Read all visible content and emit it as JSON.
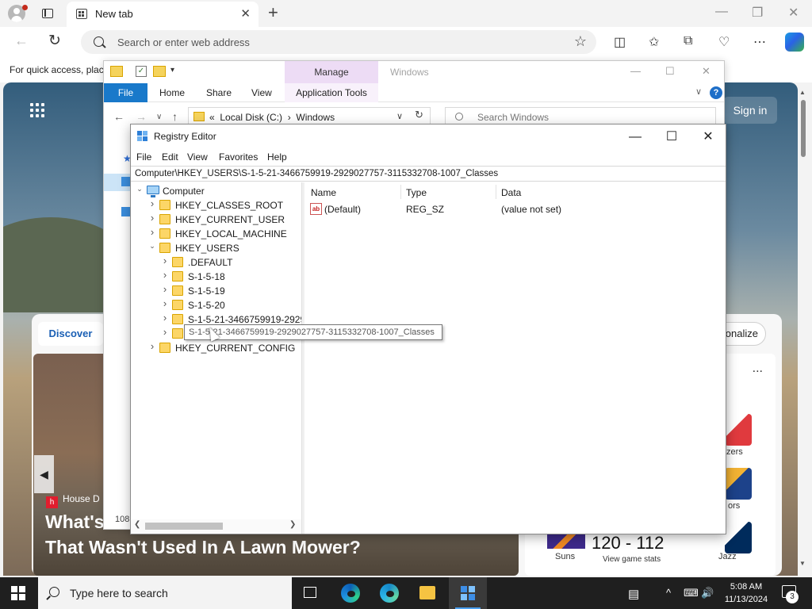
{
  "browser": {
    "tab_title": "New tab",
    "tab_close": "✕",
    "new_tab": "+",
    "window_controls": [
      "—",
      "❐",
      "✕"
    ],
    "address_placeholder": "Search or enter web address",
    "back": "←",
    "refresh": "↻",
    "favorite": "☆",
    "toolbar_icons": [
      "split-screen-icon",
      "favorites-icon",
      "collections-icon",
      "performance-icon",
      "more-icon",
      "copilot-icon"
    ],
    "quick_access_text": "For quick access, place"
  },
  "ntp": {
    "sign_in": "Sign in",
    "discover": "Discover",
    "personalize": "onalize",
    "hero_source": "House D",
    "hero_title_line1": "What's",
    "hero_title_line2": "That Wasn't Used In A Lawn Mower?",
    "sports_more": "...",
    "team1_label": "zers",
    "team2_label": "ors",
    "suns_label": "Suns",
    "score": "120 - 112",
    "score_sub": "View game stats",
    "jazz_label": "Jazz"
  },
  "explorer": {
    "manage": "Manage",
    "title": "Windows",
    "tabs": [
      "File",
      "Home",
      "Share",
      "View"
    ],
    "app_tools": "Application Tools",
    "path": [
      "Local Disk (C:)",
      "Windows"
    ],
    "path_prefix": "«",
    "search_placeholder": "Search Windows",
    "status_count": "108",
    "help": "?"
  },
  "regedit": {
    "title": "Registry Editor",
    "menu": [
      "File",
      "Edit",
      "View",
      "Favorites",
      "Help"
    ],
    "address": "Computer\\HKEY_USERS\\S-1-5-21-3466759919-2929027757-3115332708-1007_Classes",
    "tree": [
      {
        "label": "Computer",
        "level": 0,
        "expander": "down",
        "icon": "computer"
      },
      {
        "label": "HKEY_CLASSES_ROOT",
        "level": 1,
        "expander": "right",
        "icon": "folder"
      },
      {
        "label": "HKEY_CURRENT_USER",
        "level": 1,
        "expander": "right",
        "icon": "folder"
      },
      {
        "label": "HKEY_LOCAL_MACHINE",
        "level": 1,
        "expander": "right",
        "icon": "folder"
      },
      {
        "label": "HKEY_USERS",
        "level": 1,
        "expander": "down",
        "icon": "folder"
      },
      {
        "label": ".DEFAULT",
        "level": 2,
        "expander": "right",
        "icon": "folder"
      },
      {
        "label": "S-1-5-18",
        "level": 2,
        "expander": "right",
        "icon": "folder"
      },
      {
        "label": "S-1-5-19",
        "level": 2,
        "expander": "right",
        "icon": "folder"
      },
      {
        "label": "S-1-5-20",
        "level": 2,
        "expander": "right",
        "icon": "folder"
      },
      {
        "label": "S-1-5-21-3466759919-2929",
        "level": 2,
        "expander": "right",
        "icon": "folder"
      },
      {
        "label": "S-1-5-21-3466759919-2929027757-3115332708-1007_Classes",
        "level": 2,
        "expander": "right",
        "icon": "folder",
        "selected": true
      },
      {
        "label": "HKEY_CURRENT_CONFIG",
        "level": 1,
        "expander": "right",
        "icon": "folder"
      }
    ],
    "columns": [
      "Name",
      "Type",
      "Data"
    ],
    "values": [
      {
        "name": "(Default)",
        "type": "REG_SZ",
        "data": "(value not set)",
        "icon_text": "ab"
      }
    ],
    "tooltip": "S-1-5-21-3466759919-2929027757-3115332708-1007_Classes",
    "window_controls": [
      "—",
      "☐",
      "✕"
    ]
  },
  "taskbar": {
    "search_placeholder": "Type here to search",
    "apps": [
      "task-view",
      "edge",
      "edge-beta",
      "file-explorer",
      "registry-editor"
    ],
    "time": "5:08 AM",
    "date": "11/13/2024",
    "notifications_count": "3",
    "tray_icons": [
      "^",
      "⌨",
      "🔊"
    ]
  }
}
